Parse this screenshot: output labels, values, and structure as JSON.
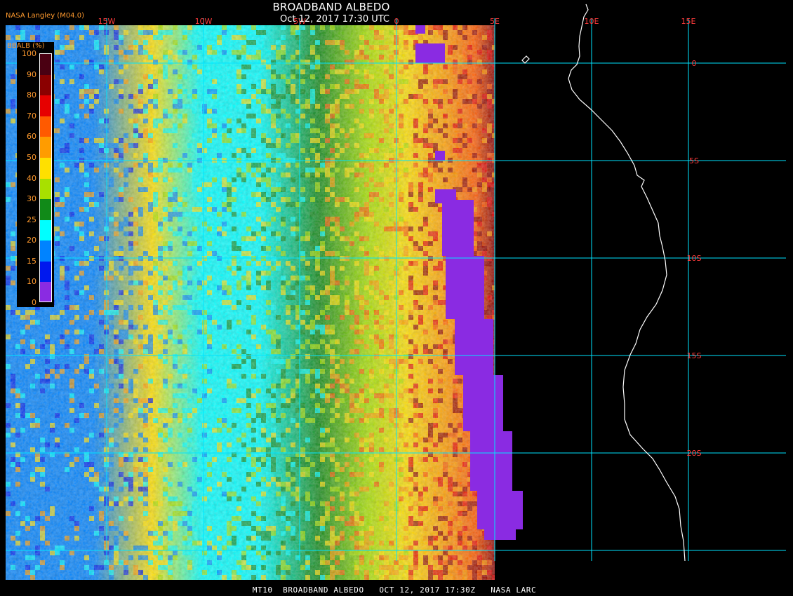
{
  "header": {
    "title": "BROADBAND ALBEDO",
    "subtitle": "Oct 12, 2017 17:30 UTC",
    "producer": "NASA Langley (M04.0)"
  },
  "footer": {
    "text": "MT10  BROADBAND ALBEDO   OCT 12, 2017 17:30Z   NASA LARC"
  },
  "legend": {
    "label": "BBALB (%)",
    "ticks": [
      "100",
      "90",
      "80",
      "70",
      "60",
      "50",
      "40",
      "30",
      "25",
      "20",
      "15",
      "10",
      "0"
    ],
    "colors": [
      "#4a0012",
      "#8b0000",
      "#e60000",
      "#ff5a00",
      "#ff9c00",
      "#ffe000",
      "#a8e000",
      "#118a18",
      "#00ffff",
      "#0083ff",
      "#0018ee",
      "#8a2be2"
    ]
  },
  "map": {
    "lon_labels": [
      "15W",
      "10W",
      "5W",
      "0",
      "5E",
      "10E",
      "15E"
    ],
    "lat_labels": [
      "0",
      "5S",
      "10S",
      "15S",
      "20S"
    ],
    "gridline_color": "#00e5ff",
    "label_color": "#ff3b3b",
    "coast_color": "#ffffff",
    "nodata_color": "#000000",
    "space_color": "#8a2be2"
  }
}
